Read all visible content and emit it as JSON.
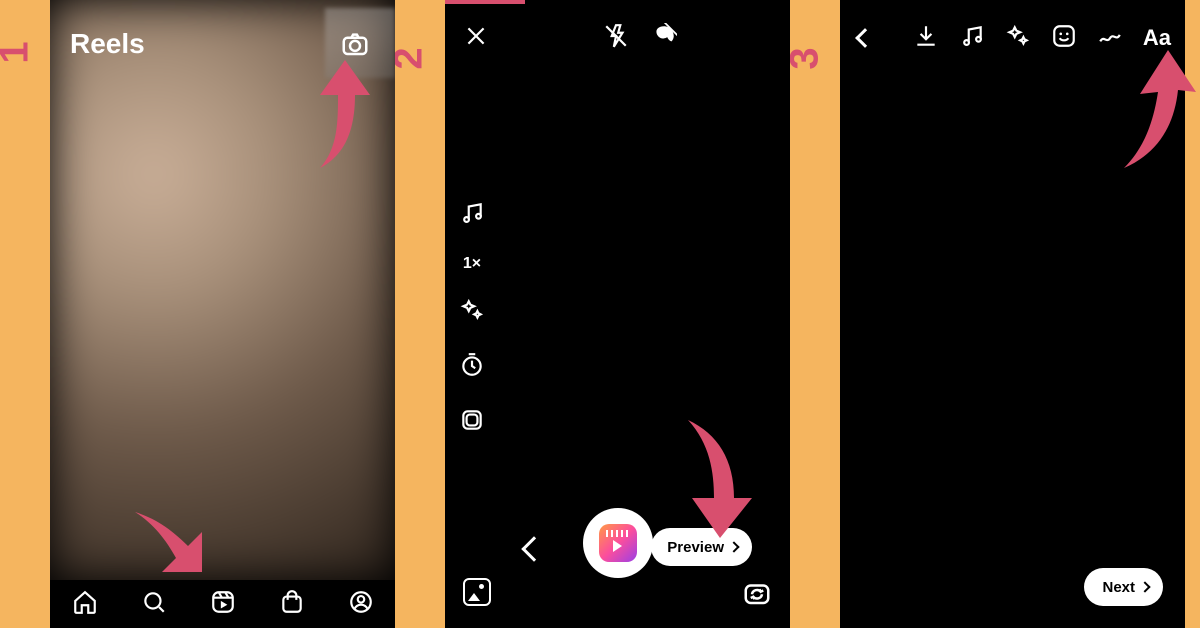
{
  "colors": {
    "accent": "#d84f6e",
    "bg": "#f5b55f"
  },
  "steps": {
    "one": "1",
    "two": "2",
    "three": "3"
  },
  "screen1": {
    "title": "Reels",
    "nav": {
      "home": "home-icon",
      "search": "search-icon",
      "reels": "reels-icon",
      "shop": "shop-icon",
      "profile": "profile-icon"
    },
    "camera_icon": "camera-icon"
  },
  "screen2": {
    "close_icon": "close-icon",
    "flash_off_icon": "flash-off-icon",
    "touchup_off_icon": "touchup-off-icon",
    "side": {
      "music": "music-icon",
      "speed_label": "1×",
      "effects": "sparkle-icon",
      "timer": "timer-icon",
      "layout": "layout-icon"
    },
    "gallery_icon": "gallery-icon",
    "flip_icon": "camera-flip-icon",
    "back_icon": "chevron-left-icon",
    "record_icon": "reels-record-button",
    "preview_label": "Preview"
  },
  "screen3": {
    "back_icon": "chevron-left-icon",
    "tools": {
      "download": "download-icon",
      "music": "music-icon",
      "effects": "sparkle-icon",
      "sticker": "sticker-icon",
      "draw": "draw-icon",
      "text_label": "Aa"
    },
    "next_label": "Next"
  }
}
